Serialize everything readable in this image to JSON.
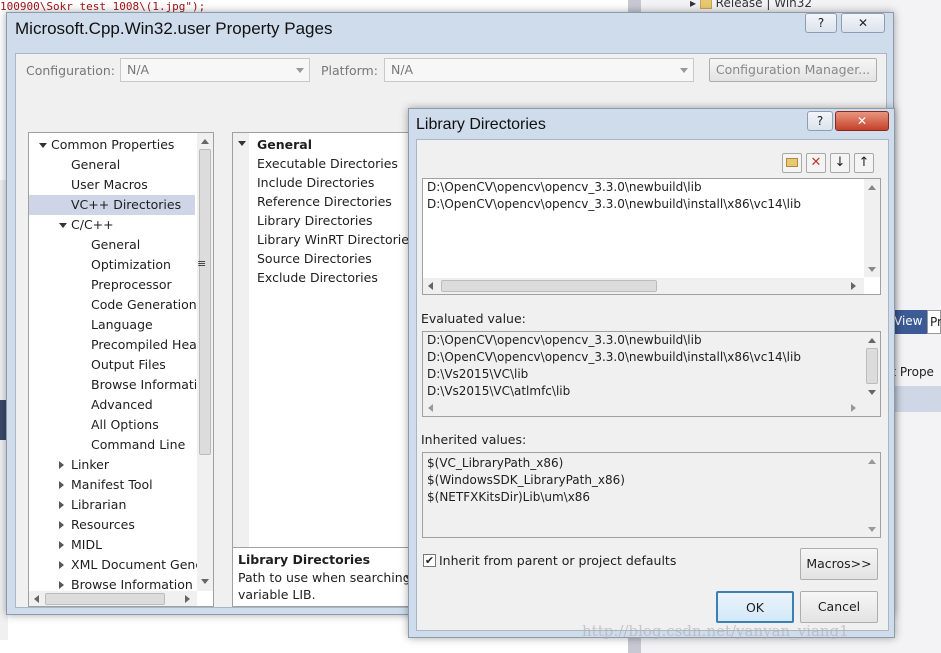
{
  "background": {
    "code_fragment": "100900\\Sokr_test_1008\\(1.jpg\");",
    "solution_item": "Release | Win32",
    "right_tab_1": "View",
    "right_tab_2": "Pr",
    "right_panel_text": "et Prope",
    "watermark": "http://blog.csdn.net/yanyan_yiang1"
  },
  "property_pages": {
    "title": "Microsoft.Cpp.Win32.user Property Pages",
    "help_button": "?",
    "close_button": "✕",
    "configuration_label": "Configuration:",
    "configuration_value": "N/A",
    "platform_label": "Platform:",
    "platform_value": "N/A",
    "config_manager_button": "Configuration Manager...",
    "tree": [
      {
        "label": "Common Properties",
        "level": 0,
        "expander": "down"
      },
      {
        "label": "General",
        "level": 1
      },
      {
        "label": "User Macros",
        "level": 1
      },
      {
        "label": "VC++ Directories",
        "level": 1,
        "selected": true
      },
      {
        "label": "C/C++",
        "level": 1,
        "expander": "down"
      },
      {
        "label": "General",
        "level": 2
      },
      {
        "label": "Optimization",
        "level": 2
      },
      {
        "label": "Preprocessor",
        "level": 2
      },
      {
        "label": "Code Generation",
        "level": 2
      },
      {
        "label": "Language",
        "level": 2
      },
      {
        "label": "Precompiled Head",
        "level": 2
      },
      {
        "label": "Output Files",
        "level": 2
      },
      {
        "label": "Browse Informatic",
        "level": 2
      },
      {
        "label": "Advanced",
        "level": 2
      },
      {
        "label": "All Options",
        "level": 2
      },
      {
        "label": "Command Line",
        "level": 2
      },
      {
        "label": "Linker",
        "level": 1,
        "expander": "right"
      },
      {
        "label": "Manifest Tool",
        "level": 1,
        "expander": "right"
      },
      {
        "label": "Librarian",
        "level": 1,
        "expander": "right"
      },
      {
        "label": "Resources",
        "level": 1,
        "expander": "right"
      },
      {
        "label": "MIDL",
        "level": 1,
        "expander": "right"
      },
      {
        "label": "XML Document Gene",
        "level": 1,
        "expander": "right"
      },
      {
        "label": "Browse Information",
        "level": 1,
        "expander": "right"
      }
    ],
    "grid_header": "General",
    "grid_items": [
      "Executable Directories",
      "Include Directories",
      "Reference Directories",
      "Library Directories",
      "Library WinRT Directories",
      "Source Directories",
      "Exclude Directories"
    ],
    "description_title": "Library Directories",
    "description_text_1": "Path to use when searching for",
    "description_text_2": "variable LIB."
  },
  "library_dialog": {
    "title": "Library Directories",
    "help_button": "?",
    "close_button": "✕",
    "toolbar": {
      "new_line_icon": "new-folder-icon",
      "delete_icon": "delete-x-icon",
      "move_down_icon": "arrow-down-icon",
      "move_up_icon": "arrow-up-icon"
    },
    "entries": [
      "D:\\OpenCV\\opencv\\opencv_3.3.0\\newbuild\\lib",
      "D:\\OpenCV\\opencv\\opencv_3.3.0\\newbuild\\install\\x86\\vc14\\lib"
    ],
    "evaluated_label": "Evaluated value:",
    "evaluated_values": [
      "D:\\OpenCV\\opencv\\opencv_3.3.0\\newbuild\\lib",
      "D:\\OpenCV\\opencv\\opencv_3.3.0\\newbuild\\install\\x86\\vc14\\lib",
      "D:\\Vs2015\\VC\\lib",
      "D:\\Vs2015\\VC\\atlmfc\\lib"
    ],
    "inherited_label": "Inherited values:",
    "inherited_values": [
      "$(VC_LibraryPath_x86)",
      "$(WindowsSDK_LibraryPath_x86)",
      "$(NETFXKitsDir)Lib\\um\\x86"
    ],
    "inherit_checkbox_label": "Inherit from parent or project defaults",
    "inherit_checked": true,
    "macros_button": "Macros>>",
    "ok_button": "OK",
    "cancel_button": "Cancel"
  }
}
